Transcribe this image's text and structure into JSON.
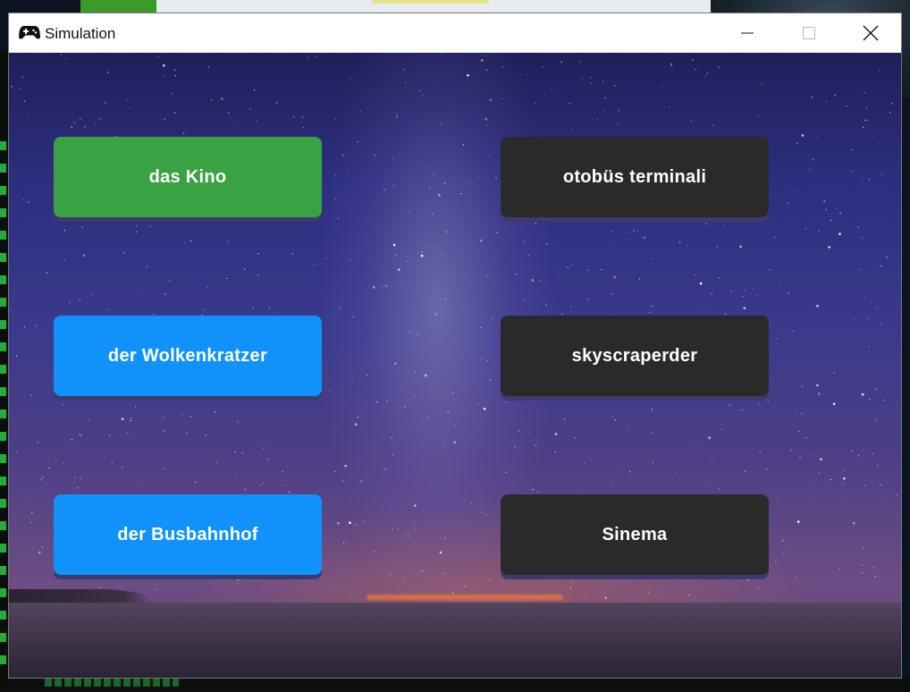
{
  "window": {
    "title": "Simulation",
    "icon": "gamepad-icon"
  },
  "controls": {
    "minimize": "minimize-icon",
    "maximize": "maximize-icon",
    "close": "close-icon"
  },
  "left_buttons": [
    {
      "label": "das Kino",
      "color": "#3aa242"
    },
    {
      "label": "der Wolkenkratzer",
      "color": "#1192fb"
    },
    {
      "label": "der Busbahnhof",
      "color": "#1192fb"
    }
  ],
  "right_buttons": [
    {
      "label": "otobüs terminali",
      "color": "#2a2a2a"
    },
    {
      "label": "skyscraperder",
      "color": "#2a2a2a"
    },
    {
      "label": "Sinema",
      "color": "#2a2a2a"
    }
  ]
}
